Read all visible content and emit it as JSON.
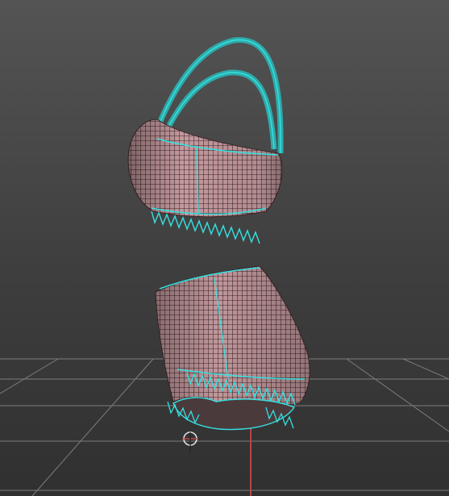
{
  "viewport": {
    "background_top": "#545454",
    "background_bottom": "#303030"
  },
  "colors": {
    "mesh_fill": "#c49a9e",
    "mesh_shade": "#8f6a6e",
    "wire": "#3a2428",
    "seam": "#35e0e0",
    "grid": "#7d7d7d",
    "axis_red": "#b84545",
    "pivot": "#e0e0e0"
  },
  "objects": [
    {
      "name": "bra-top",
      "icon": "mesh-object"
    },
    {
      "name": "shorts",
      "icon": "mesh-object"
    }
  ],
  "icons": {
    "pivot": "crosshair-circle-icon"
  }
}
